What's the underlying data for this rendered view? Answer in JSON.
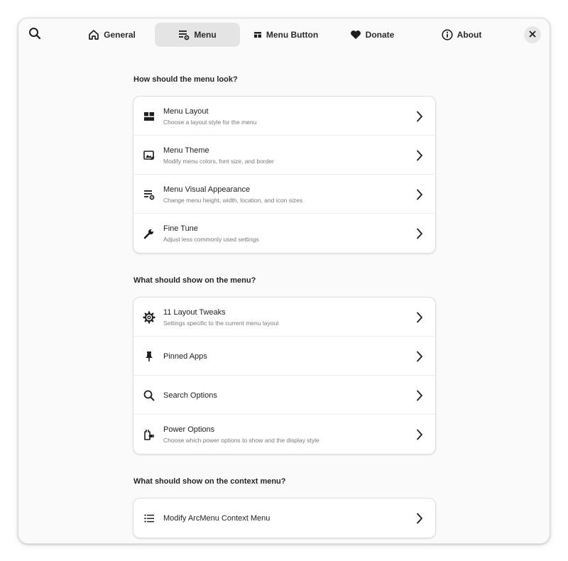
{
  "header": {
    "search_icon": "search-icon",
    "close_icon": "close-icon",
    "tabs": [
      {
        "label": "General",
        "icon": "home-icon",
        "active": false
      },
      {
        "label": "Menu",
        "icon": "menu-settings-icon",
        "active": true
      },
      {
        "label": "Menu Button",
        "icon": "menu-button-icon",
        "active": false
      },
      {
        "label": "Donate",
        "icon": "heart-icon",
        "active": false
      },
      {
        "label": "About",
        "icon": "info-icon",
        "active": false
      }
    ]
  },
  "sections": [
    {
      "title": "How should the menu look?",
      "rows": [
        {
          "title": "Menu Layout",
          "subtitle": "Choose a layout style for the menu",
          "icon": "layout-icon"
        },
        {
          "title": "Menu Theme",
          "subtitle": "Modify menu colors, font size, and border",
          "icon": "theme-edit-icon"
        },
        {
          "title": "Menu Visual Appearance",
          "subtitle": "Change menu height, width, location, and icon sizes",
          "icon": "menu-settings-icon"
        },
        {
          "title": "Fine Tune",
          "subtitle": "Adjust less commonly used settings",
          "icon": "wrench-icon"
        }
      ]
    },
    {
      "title": "What should show on the menu?",
      "rows": [
        {
          "title": "11 Layout Tweaks",
          "subtitle": "Settings specific to the current menu layout",
          "icon": "gear-icon"
        },
        {
          "title": "Pinned Apps",
          "subtitle": "",
          "icon": "pin-icon"
        },
        {
          "title": "Search Options",
          "subtitle": "",
          "icon": "search-icon"
        },
        {
          "title": "Power Options",
          "subtitle": "Choose which power options to show and the display style",
          "icon": "power-plug-icon"
        }
      ]
    },
    {
      "title": "What should show on the context menu?",
      "rows": [
        {
          "title": "Modify ArcMenu Context Menu",
          "subtitle": "",
          "icon": "list-icon"
        }
      ]
    }
  ]
}
